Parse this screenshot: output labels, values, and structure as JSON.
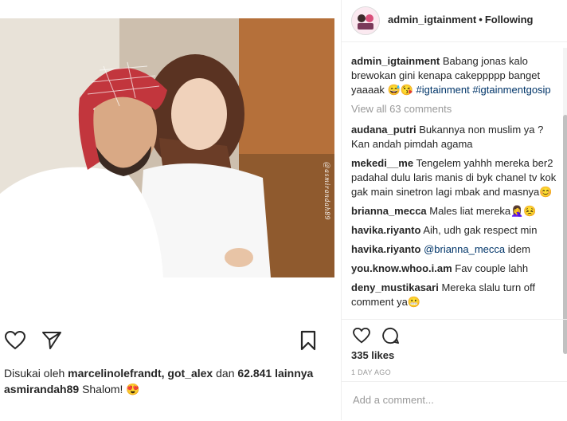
{
  "post": {
    "photo_watermark": "@asmirandah89",
    "left": {
      "liked_by_prefix": "Disukai oleh",
      "liked_by_user1": "marcelinolefrandt",
      "liked_by_sep": ",",
      "liked_by_user2": "got_alex",
      "liked_by_and": "dan",
      "liked_by_count": "62.841",
      "liked_by_suffix": "lainnya",
      "caption_user": "asmirandah89",
      "caption_text": "Shalom! 😍"
    }
  },
  "header": {
    "username": "admin_igtainment",
    "dot": "•",
    "follow_status": "Following"
  },
  "caption": {
    "user": "admin_igtainment",
    "text": "Babang jonas kalo brewokan gini kenapa cakeppppp banget yaaaak 😅😘",
    "tag1": "#igtainment",
    "tag2": "#igtainmentgosip"
  },
  "view_all": "View all 63 comments",
  "comments": [
    {
      "user": "audana_putri",
      "text": "Bukannya non muslim ya ? Kan andah pimdah agama"
    },
    {
      "user": "mekedi__me",
      "text": "Tengelem yahhh mereka ber2 padahal dulu laris manis di byk chanel tv kok gak main sinetron lagi mbak and masnya😊"
    },
    {
      "user": "brianna_mecca",
      "text": "Males liat mereka🤦‍♀️😣"
    },
    {
      "user": "havika.riyanto",
      "text": "Aih, udh gak respect min"
    },
    {
      "user": "havika.riyanto",
      "mention": "@brianna_mecca",
      "text": "idem"
    },
    {
      "user": "you.know.whoo.i.am",
      "text": "Fav couple lahh"
    },
    {
      "user": "deny_mustikasari",
      "text": "Mereka slalu turn off comment ya😬"
    }
  ],
  "likes": "335 likes",
  "timestamp": "1 DAY AGO",
  "add_comment_placeholder": "Add a comment...",
  "icons": {
    "like": "heart-icon",
    "comment": "comment-icon",
    "share": "share-icon",
    "save": "bookmark-icon"
  }
}
